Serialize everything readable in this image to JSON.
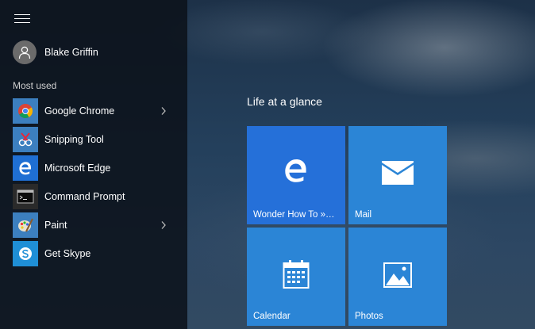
{
  "start_menu": {
    "user": {
      "name": "Blake Griffin"
    },
    "most_used_label": "Most used",
    "apps": [
      {
        "label": "Google Chrome",
        "icon": "chrome-icon",
        "has_submenu": true
      },
      {
        "label": "Snipping Tool",
        "icon": "snipping-tool-icon",
        "has_submenu": false
      },
      {
        "label": "Microsoft Edge",
        "icon": "edge-icon",
        "has_submenu": false
      },
      {
        "label": "Command Prompt",
        "icon": "command-prompt-icon",
        "has_submenu": false
      },
      {
        "label": "Paint",
        "icon": "paint-icon",
        "has_submenu": true
      },
      {
        "label": "Get Skype",
        "icon": "skype-icon",
        "has_submenu": false
      }
    ]
  },
  "tile_group": {
    "title": "Life at a glance",
    "tiles": [
      {
        "label": "Wonder How To »…",
        "icon": "edge-icon",
        "color": "#2570d9"
      },
      {
        "label": "Mail",
        "icon": "mail-icon",
        "color": "#2b85d6"
      },
      {
        "label": "Calendar",
        "icon": "calendar-icon",
        "color": "#2b85d6"
      },
      {
        "label": "Photos",
        "icon": "photos-icon",
        "color": "#2b85d6"
      }
    ]
  },
  "colors": {
    "tile_blue": "#2b85d6",
    "edge_tile_blue": "#2570d9",
    "menu_background": "#0c121a"
  }
}
